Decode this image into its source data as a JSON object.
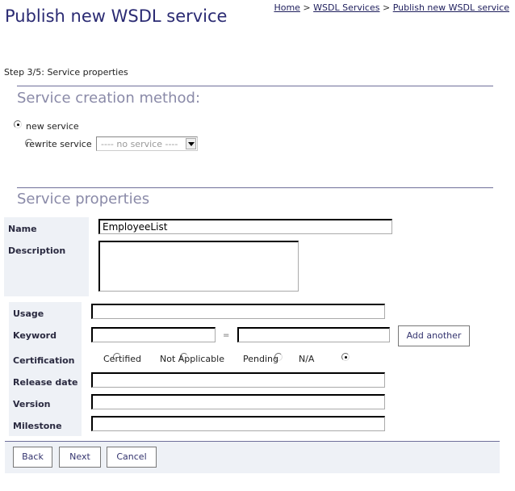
{
  "header": {
    "title": "Publish new WSDL service",
    "breadcrumb": [
      {
        "label": "Home"
      },
      {
        "label": "WSDL Services"
      },
      {
        "label": "Publish new WSDL service"
      }
    ],
    "breadcrumb_separator": ">"
  },
  "step": "Step 3/5: Service properties",
  "creation_method": {
    "heading": "Service creation method:",
    "options": [
      {
        "label": "new service",
        "selected": true
      },
      {
        "label": "rewrite service",
        "selected": false
      }
    ],
    "service_select": {
      "value": "---- no service ----",
      "enabled": false
    }
  },
  "properties": {
    "heading": "Service properties",
    "name": {
      "label": "Name",
      "value": "EmployeeList"
    },
    "description": {
      "label": "Description",
      "value": ""
    },
    "usage": {
      "label": "Usage",
      "value": ""
    },
    "keyword": {
      "label": "Keyword",
      "key": "",
      "separator": "=",
      "value": "",
      "add_label": "Add another"
    },
    "certification": {
      "label": "Certification",
      "options": [
        {
          "label": "Certified",
          "selected": false
        },
        {
          "label": "Not Applicable",
          "selected": false
        },
        {
          "label": "Pending",
          "selected": false
        },
        {
          "label": "N/A",
          "selected": true
        }
      ]
    },
    "release_date": {
      "label": "Release date",
      "value": ""
    },
    "version": {
      "label": "Version",
      "value": ""
    },
    "milestone": {
      "label": "Milestone",
      "value": ""
    }
  },
  "footer": {
    "back_label": "Back",
    "next_label": "Next",
    "cancel_label": "Cancel"
  }
}
